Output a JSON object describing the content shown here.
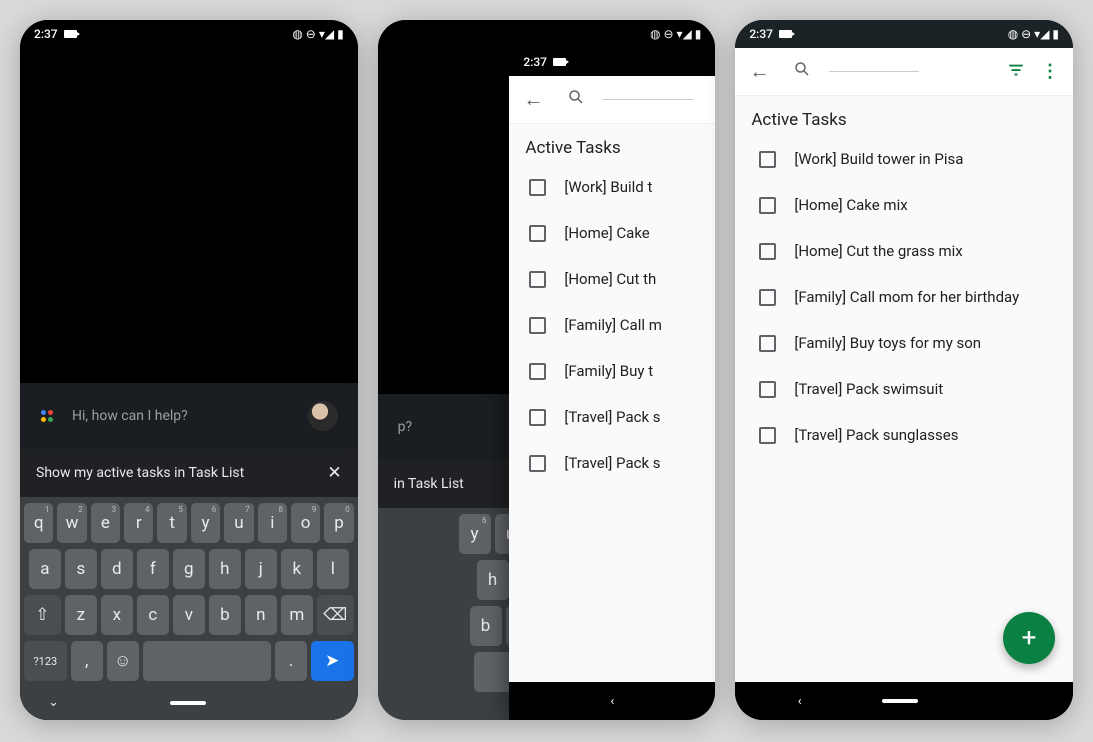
{
  "status": {
    "time": "2:37",
    "icons": "◍ ⊖ ▾◢ ▮"
  },
  "assistant": {
    "prompt": "Hi, how can I help?",
    "prompt_short": "p?",
    "input_text": "Show my active tasks in Task List",
    "input_text_short": "in Task List",
    "logo_colors": [
      "#4285F4",
      "#EA4335",
      "#FBBC05",
      "#34A853"
    ]
  },
  "keyboard": {
    "row1": [
      [
        "q",
        "1"
      ],
      [
        "w",
        "2"
      ],
      [
        "e",
        "3"
      ],
      [
        "r",
        "4"
      ],
      [
        "t",
        "5"
      ],
      [
        "y",
        "6"
      ],
      [
        "u",
        "7"
      ],
      [
        "i",
        "8"
      ],
      [
        "o",
        "9"
      ],
      [
        "p",
        "0"
      ]
    ],
    "row2": [
      "a",
      "s",
      "d",
      "f",
      "g",
      "h",
      "j",
      "k",
      "l"
    ],
    "row3": [
      "z",
      "x",
      "c",
      "v",
      "b",
      "n",
      "m"
    ],
    "shift": "⇧",
    "backspace": "⌫",
    "numkey": "?123",
    "comma": ",",
    "emoji": "☺",
    "period": ".",
    "send": "➤",
    "nav_down": "⌄"
  },
  "tasks": {
    "header": "Active Tasks",
    "items": [
      "[Work] Build tower in Pisa",
      "[Home] Cake mix",
      "[Home] Cut the grass mix",
      "[Family] Call mom for her birthday",
      "[Family] Buy toys for my son",
      "[Travel] Pack swimsuit",
      "[Travel] Pack sunglasses"
    ],
    "items_partial": [
      "[Work] Build t",
      "[Home] Cake",
      "[Home] Cut th",
      "[Family] Call m",
      "[Family] Buy t",
      "[Travel] Pack s",
      "[Travel] Pack s"
    ]
  },
  "topbar": {
    "back": "←",
    "filter": "≡",
    "more": "⋮",
    "fab": "+"
  },
  "nav": {
    "back": "‹"
  }
}
